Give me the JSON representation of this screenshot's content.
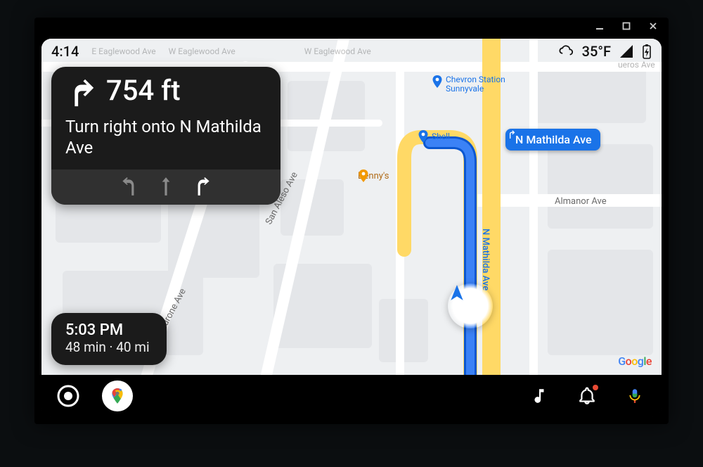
{
  "titlebar": {
    "minimize": "—",
    "maximize": "▢",
    "close": "✕"
  },
  "status": {
    "time": "4:14",
    "streets": [
      "E Eaglewood Ave",
      "W Eaglewood Ave",
      "W Eaglewood Ave"
    ],
    "temp": "35°F"
  },
  "nav": {
    "distance": "754 ft",
    "instruction": "Turn right onto N Mathilda Ave"
  },
  "eta": {
    "arrival": "5:03 PM",
    "summary": "48 min · 40 mi"
  },
  "route_chip": {
    "label": "N Mathilda Ave"
  },
  "map": {
    "road_labels": {
      "san_aleso": "San Aleso Ave",
      "madrone": "Madrone Ave",
      "almanor": "Almanor Ave",
      "mathilda_v": "N Mathilda Ave",
      "ueros": "ueros Ave"
    },
    "pois": {
      "chevron": "Chevron Station Sunnyvale",
      "shell": "Shell",
      "dennys": "Denny's"
    },
    "attribution": "Google"
  },
  "bottombar": {
    "launcher": "launcher",
    "maps": "maps",
    "music": "music",
    "notifications": "notifications",
    "voice": "voice"
  }
}
